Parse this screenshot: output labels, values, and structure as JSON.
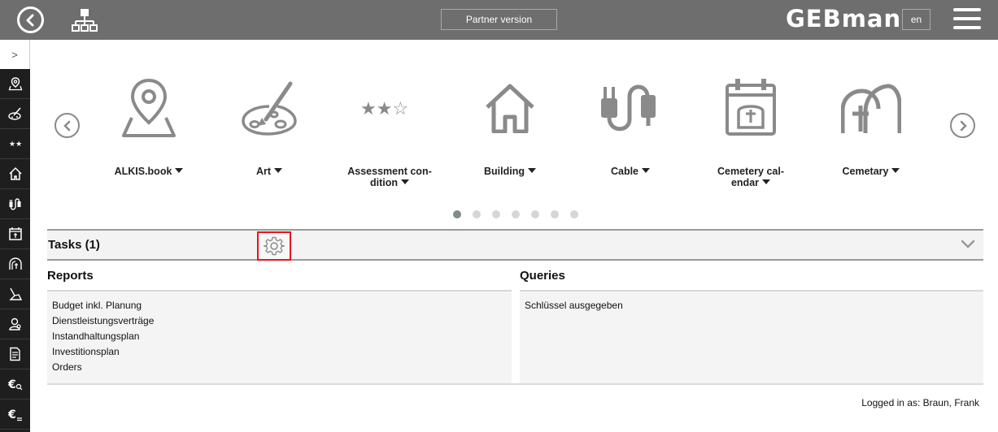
{
  "header": {
    "partner_label": "Partner version",
    "logo": "GEBman",
    "language": "en"
  },
  "sidebar": {
    "toggle": ">",
    "items": [
      {
        "icon": "map-pin-icon"
      },
      {
        "icon": "art-palette-icon"
      },
      {
        "icon": "stars-icon"
      },
      {
        "icon": "house-icon"
      },
      {
        "icon": "cable-icon"
      },
      {
        "icon": "calendar-icon"
      },
      {
        "icon": "cemetery-icon"
      },
      {
        "icon": "cleaning-icon"
      },
      {
        "icon": "person-search-icon"
      },
      {
        "icon": "document-icon"
      },
      {
        "icon": "euro-search-icon"
      },
      {
        "icon": "euro-plan-icon"
      }
    ]
  },
  "carousel": {
    "categories": [
      {
        "label": "ALKIS.book",
        "icon": "map-pin-icon"
      },
      {
        "label": "Art",
        "icon": "art-palette-icon"
      },
      {
        "label": "Assessment con-\ndition",
        "icon": "stars-icon"
      },
      {
        "label": "Building",
        "icon": "house-icon"
      },
      {
        "label": "Cable",
        "icon": "cable-icon"
      },
      {
        "label": "Cemetery cal-\nendar",
        "icon": "calendar-icon"
      },
      {
        "label": "Cemetary",
        "icon": "cemetery-icon"
      }
    ],
    "page_count": 7,
    "active_page": 1
  },
  "tasks": {
    "title": "Tasks (1)"
  },
  "reports": {
    "title": "Reports",
    "items": [
      "Budget inkl. Planung",
      "Dienstleistungsverträge",
      "Instandhaltungsplan",
      "Investitionsplan",
      "Orders"
    ]
  },
  "queries": {
    "title": "Queries",
    "items": [
      "Schlüssel ausgegeben"
    ]
  },
  "footer": {
    "logged_in": "Logged in as: Braun, Frank"
  },
  "colors": {
    "header_bg": "#6e6e6e",
    "sidebar_bg": "#1e1e1e",
    "highlight_border": "#e8141b",
    "icon_gray": "#8a8a8a"
  }
}
